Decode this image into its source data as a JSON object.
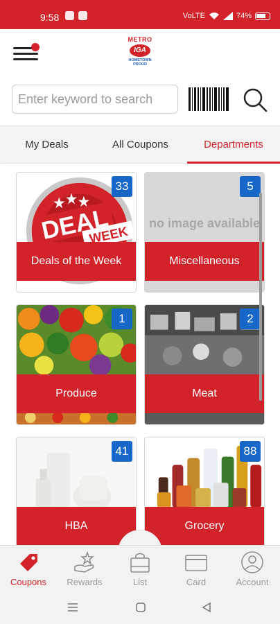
{
  "status_bar": {
    "time": "9:58",
    "network": "VoLTE",
    "battery": "74%"
  },
  "header": {
    "logo": {
      "brand_top": "METRO",
      "brand_mid": "IGA",
      "brand_bottom": "HOMETOWN PROUD"
    },
    "menu_notification": true
  },
  "search": {
    "placeholder": "Enter keyword to search"
  },
  "tabs": [
    {
      "label": "My Deals",
      "active": false
    },
    {
      "label": "All Coupons",
      "active": false
    },
    {
      "label": "Departments",
      "active": true
    }
  ],
  "departments": [
    {
      "label": "Deals of the Week",
      "count": "33",
      "image_text": "DEAL OF THE WEEK"
    },
    {
      "label": "Miscellaneous",
      "count": "5",
      "image_text": "no image available"
    },
    {
      "label": "Produce",
      "count": "1"
    },
    {
      "label": "Meat",
      "count": "2"
    },
    {
      "label": "HBA",
      "count": "41"
    },
    {
      "label": "Grocery",
      "count": "88"
    }
  ],
  "bottom_nav": [
    {
      "label": "Coupons",
      "icon": "tag-icon",
      "active": true
    },
    {
      "label": "Rewards",
      "icon": "rewards-icon",
      "active": false
    },
    {
      "label": "List",
      "icon": "shopping-bag-icon",
      "active": false
    },
    {
      "label": "Card",
      "icon": "card-icon",
      "active": false
    },
    {
      "label": "Account",
      "icon": "account-icon",
      "active": false
    }
  ],
  "colors": {
    "brand_red": "#d3232a",
    "badge_blue": "#1767c9"
  }
}
